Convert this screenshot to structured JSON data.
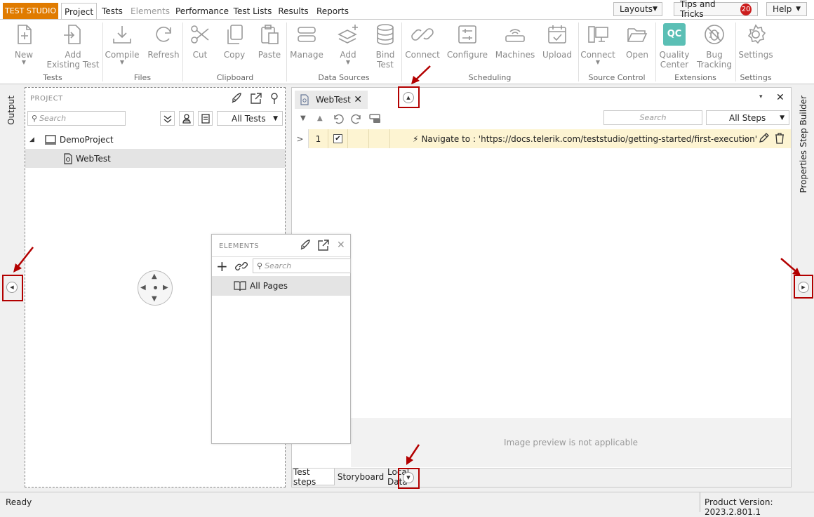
{
  "app": {
    "name": "TEST STUDIO"
  },
  "menu": {
    "tabs": [
      {
        "label": "Project"
      },
      {
        "label": "Tests"
      },
      {
        "label": "Elements"
      },
      {
        "label": "Performance"
      },
      {
        "label": "Test Lists"
      },
      {
        "label": "Results"
      },
      {
        "label": "Reports"
      }
    ],
    "layouts_label": "Layouts",
    "tips_label": "Tips and Tricks",
    "tips_count": "20",
    "help_label": "Help"
  },
  "ribbon": {
    "buttons": {
      "new": "New",
      "add_existing_1": "Add",
      "add_existing_2": "Existing Test",
      "compile": "Compile",
      "refresh": "Refresh",
      "cut": "Cut",
      "copy": "Copy",
      "paste": "Paste",
      "manage": "Manage",
      "add": "Add",
      "bind_1": "Bind",
      "bind_2": "Test",
      "connect": "Connect",
      "configure": "Configure",
      "machines": "Machines",
      "upload": "Upload",
      "sc_connect": "Connect",
      "open": "Open",
      "quality_1": "Quality",
      "quality_2": "Center",
      "quality_icon_text": "QC",
      "bug_1": "Bug",
      "bug_2": "Tracking",
      "settings": "Settings"
    },
    "groups": {
      "tests": "Tests",
      "files": "Files",
      "clipboard": "Clipboard",
      "data_sources": "Data Sources",
      "scheduling": "Scheduling",
      "source_control": "Source Control",
      "extensions": "Extensions",
      "settings": "Settings"
    },
    "accent": "#5bbfb5"
  },
  "left_strip": {
    "label": "Output"
  },
  "right_strip": {
    "labels": [
      "Step Builder",
      "Properties"
    ]
  },
  "project": {
    "header": "PROJECT",
    "search_placeholder": "Search",
    "filter_label": "All Tests",
    "tree": [
      {
        "label": "DemoProject",
        "icon": "project-icon"
      },
      {
        "label": "WebTest",
        "icon": "test-file-icon"
      }
    ]
  },
  "elements": {
    "header": "ELEMENTS",
    "search_placeholder": "Search",
    "items": [
      {
        "label": "All Pages",
        "icon": "book-icon"
      }
    ]
  },
  "test": {
    "tab_label": "WebTest",
    "search_placeholder": "Search",
    "filter_label": "All Steps",
    "steps": [
      {
        "index": "1",
        "checked": true,
        "description": "Navigate to : 'https://docs.telerik.com/teststudio/getting-started/first-execution'"
      }
    ],
    "preview_text": "Image preview is not applicable",
    "bottom_tabs": [
      "Test steps",
      "Storyboard",
      "Local Data"
    ]
  },
  "status": {
    "text": "Ready",
    "version": "Product Version: 2023.2.801.1"
  },
  "colors": {
    "brand": "#e07b00",
    "highlight_row": "#fdf4d2",
    "annotation": "#b30000",
    "badge": "#cc1e1e"
  }
}
